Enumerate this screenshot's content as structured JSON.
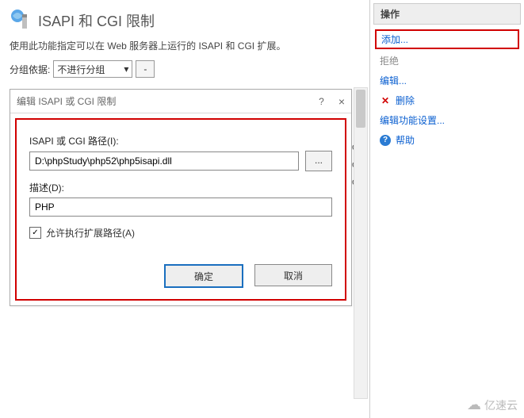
{
  "header": {
    "title": "ISAPI 和 CGI 限制"
  },
  "description": "使用此功能指定可以在 Web 服务器上运行的 ISAPI 和 CGI 扩展。",
  "grouping": {
    "label": "分组依据:",
    "selected": "不进行分组",
    "dash": "▾",
    "extra": "-"
  },
  "dialog": {
    "title": "编辑 ISAPI 或 CGI 限制",
    "help": "?",
    "close": "×",
    "path_label": "ISAPI 或 CGI 路径(I):",
    "path_value": "D:\\phpStudy\\php52\\php5isapi.dll",
    "browse": "...",
    "desc_label": "描述(D):",
    "desc_value": "PHP",
    "allow_label": "允许执行扩展路径(A)",
    "allow_checked": "✓",
    "ok": "确定",
    "cancel": "取消"
  },
  "bg_rows": [
    "|",
    "I|",
    "vo",
    "vo",
    "vo"
  ],
  "side": {
    "title": "操作",
    "add": "添加...",
    "deny": "拒绝",
    "edit": "编辑...",
    "delete": "删除",
    "feature": "编辑功能设置...",
    "help": "帮助"
  },
  "watermark": "亿速云"
}
